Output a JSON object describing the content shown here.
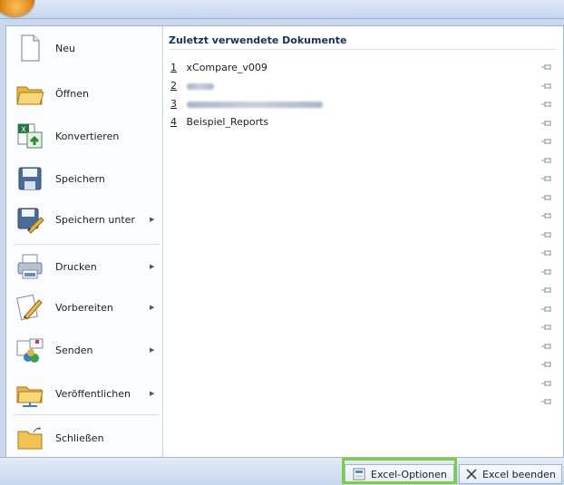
{
  "menu": {
    "items": [
      {
        "label": "Neu",
        "submenu": false,
        "icon": "new-document-icon"
      },
      {
        "label": "Öffnen",
        "submenu": false,
        "icon": "open-folder-icon"
      },
      {
        "label": "Konvertieren",
        "submenu": false,
        "icon": "convert-icon"
      },
      {
        "label": "Speichern",
        "submenu": false,
        "icon": "save-disk-icon"
      },
      {
        "label": "Speichern unter",
        "submenu": true,
        "icon": "save-as-icon"
      },
      {
        "label": "Drucken",
        "submenu": true,
        "icon": "printer-icon"
      },
      {
        "label": "Vorbereiten",
        "submenu": true,
        "icon": "prepare-icon"
      },
      {
        "label": "Senden",
        "submenu": true,
        "icon": "send-icon"
      },
      {
        "label": "Veröffentlichen",
        "submenu": true,
        "icon": "publish-icon"
      },
      {
        "label": "Schließen",
        "submenu": false,
        "icon": "close-folder-icon"
      }
    ],
    "submenu_arrow": "▶"
  },
  "recent": {
    "title": "Zuletzt verwendete Dokumente",
    "documents": [
      {
        "num": "1",
        "name": "xCompare_v009"
      },
      {
        "num": "2",
        "name": ""
      },
      {
        "num": "3",
        "name": ""
      },
      {
        "num": "4",
        "name": "Beispiel_Reports"
      }
    ]
  },
  "footer": {
    "options_label": "Excel-Optionen",
    "exit_label": "Excel beenden",
    "highlight_color": "#7bd03a"
  }
}
